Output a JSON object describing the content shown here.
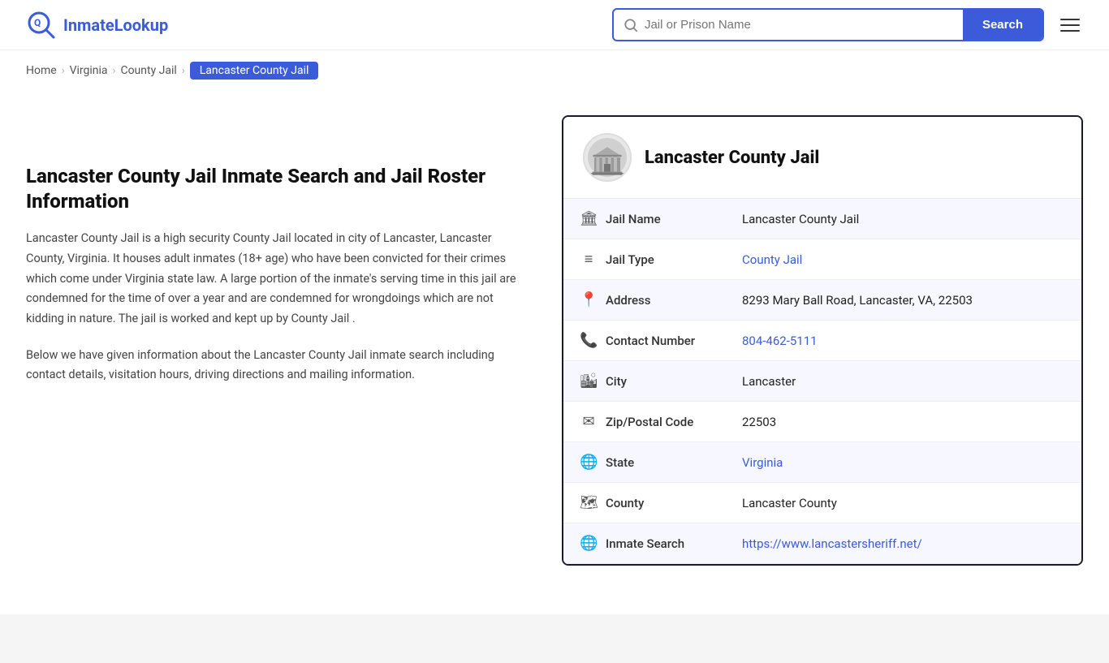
{
  "logo": {
    "text_part1": "Inmate",
    "text_part2": "Lookup"
  },
  "header": {
    "search_placeholder": "Jail or Prison Name",
    "search_button_label": "Search"
  },
  "breadcrumb": {
    "home": "Home",
    "state": "Virginia",
    "type": "County Jail",
    "current": "Lancaster County Jail"
  },
  "page": {
    "title": "Lancaster County Jail Inmate Search and Jail Roster Information",
    "description1": "Lancaster County Jail is a high security County Jail located in city of Lancaster, Lancaster County, Virginia. It houses adult inmates (18+ age) who have been convicted for their crimes which come under Virginia state law. A large portion of the inmate's serving time in this jail are condemned for the time of over a year and are condemned for wrongdoings which are not kidding in nature. The jail is worked and kept up by County Jail .",
    "description2": "Below we have given information about the Lancaster County Jail inmate search including contact details, visitation hours, driving directions and mailing information."
  },
  "info_card": {
    "title": "Lancaster County Jail",
    "rows": [
      {
        "icon": "🏛",
        "label": "Jail Name",
        "value": "Lancaster County Jail",
        "link": null
      },
      {
        "icon": "≡",
        "label": "Jail Type",
        "value": "County Jail",
        "link": "#"
      },
      {
        "icon": "📍",
        "label": "Address",
        "value": "8293 Mary Ball Road, Lancaster, VA, 22503",
        "link": null
      },
      {
        "icon": "📞",
        "label": "Contact Number",
        "value": "804-462-5111",
        "link": "tel:804-462-5111"
      },
      {
        "icon": "🏙",
        "label": "City",
        "value": "Lancaster",
        "link": null
      },
      {
        "icon": "✉",
        "label": "Zip/Postal Code",
        "value": "22503",
        "link": null
      },
      {
        "icon": "🌐",
        "label": "State",
        "value": "Virginia",
        "link": "#"
      },
      {
        "icon": "🗺",
        "label": "County",
        "value": "Lancaster County",
        "link": null
      },
      {
        "icon": "🌐",
        "label": "Inmate Search",
        "value": "https://www.lancastersheriff.net/",
        "link": "https://www.lancastersheriff.net/"
      }
    ]
  }
}
